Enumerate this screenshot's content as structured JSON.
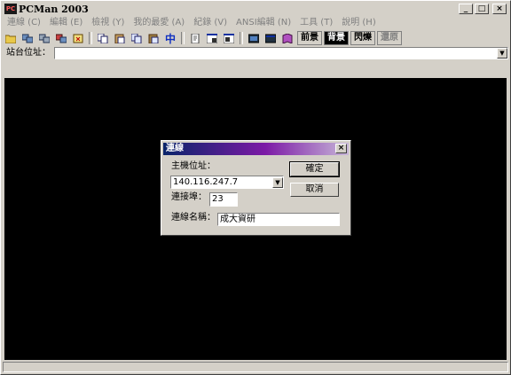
{
  "window": {
    "title": "PCMan 2003",
    "app_icon_text": "PC"
  },
  "titlebar_buttons": {
    "minimize": "_",
    "maximize": "□",
    "close": "×"
  },
  "menu": [
    "連線 (C)",
    "編輯 (E)",
    "檢視 (Y)",
    "我的最愛 (A)",
    "紀錄 (V)",
    "ANSI編輯 (N)",
    "工具 (T)",
    "說明 (H)"
  ],
  "toolbar": {
    "ime_button": "中",
    "text_buttons": [
      "前景",
      "背景",
      "閃爍",
      "還原"
    ]
  },
  "address_bar": {
    "label": "站台位址：",
    "value": ""
  },
  "dialog": {
    "title": "連線",
    "host_label": "主機位址：",
    "host_value": "140.116.247.7",
    "port_label": "連接埠：",
    "port_value": "23",
    "name_label": "連線名稱：",
    "name_value": "成大資研",
    "ok_label": "確定",
    "cancel_label": "取消"
  },
  "colors": {
    "face": "#d4d0c8",
    "terminal": "#000000",
    "dialog_title_start": "#0a246a",
    "dialog_title_mid": "#7c1aa6"
  }
}
